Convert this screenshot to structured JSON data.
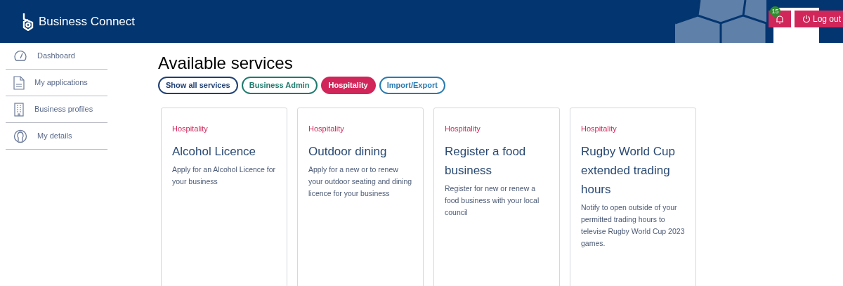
{
  "header": {
    "brand": "Business Connect",
    "notification_badge": "15",
    "logout": "Log out"
  },
  "sidebar": {
    "items": [
      {
        "label": "Dashboard",
        "kind": "gauge"
      },
      {
        "label": "My applications",
        "kind": "document"
      },
      {
        "label": "Business profiles",
        "kind": "building"
      },
      {
        "label": "My details",
        "kind": "person"
      }
    ]
  },
  "page_title": "Available services",
  "filters": [
    {
      "label": "Show all services",
      "color": "#1f3f73",
      "selected": false
    },
    {
      "label": "Business Admin",
      "color": "#1f7a6d",
      "selected": false
    },
    {
      "label": "Hospitality",
      "color": "#d1265a",
      "selected": true
    },
    {
      "label": "Import/Export",
      "color": "#2a7ab0",
      "selected": false
    }
  ],
  "cards": [
    {
      "category": "Hospitality",
      "title": "Alcohol Licence",
      "description": "Apply for an Alcohol Licence for your business"
    },
    {
      "category": "Hospitality",
      "title": "Outdoor dining",
      "description": "Apply for a new or to renew your outdoor seating and dining licence for your business"
    },
    {
      "category": "Hospitality",
      "title": "Register a food business",
      "description": "Register for new or renew a food business with your local council"
    },
    {
      "category": "Hospitality",
      "title": "Rugby World Cup extended trading hours",
      "description": "Notify to open outside of your permitted trading hours to televise Rugby World Cup 2023 games."
    }
  ]
}
